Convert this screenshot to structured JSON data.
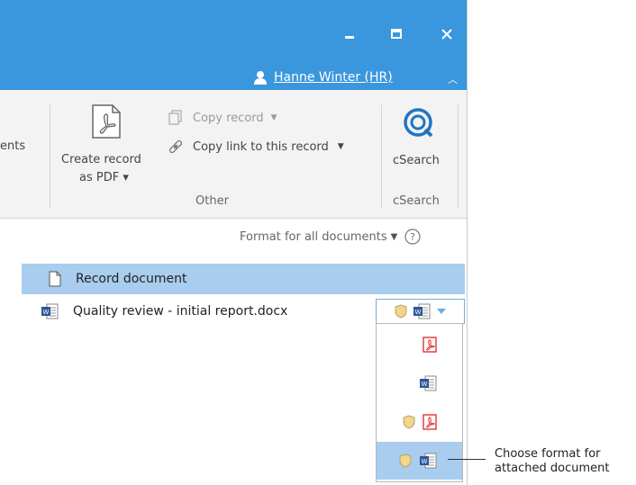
{
  "user": {
    "name": "Hanne Winter (HR)"
  },
  "ribbon": {
    "left_cut_label": "ents",
    "create_pdf_line1": "Create record",
    "create_pdf_line2": "as PDF ▾",
    "copy_record": "Copy record",
    "copy_link": "Copy link to this record",
    "group_other": "Other",
    "csearch_button": "cSearch",
    "group_csearch": "cSearch"
  },
  "documents": {
    "format_all_label": "Format for all documents",
    "record_document": "Record document",
    "attached_document": "Quality review - initial report.docx"
  },
  "format_options": [
    "pdf",
    "word",
    "protected-pdf",
    "protected-word"
  ],
  "callout": {
    "line1": "Choose format for",
    "line2": "attached document"
  },
  "colors": {
    "titlebar": "#3a96dd",
    "selection": "#a9cdee",
    "pdf_red": "#e02424",
    "word_blue": "#2b5797"
  }
}
